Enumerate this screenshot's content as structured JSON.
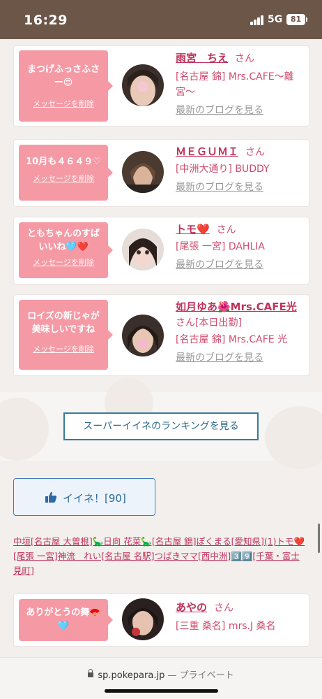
{
  "status_bar": {
    "time": "16:29",
    "network": "5G",
    "battery": "81"
  },
  "cards": [
    {
      "message": "まつげふっさふさー😍",
      "delete_label": "メッセージを削除",
      "name": "雨宮　ちえ",
      "suffix": "さん",
      "shop": "[名古屋 錦] Mrs.CAFE～離宮～",
      "blog_label": "最新のブログを見る"
    },
    {
      "message": "10月も４６４９♡",
      "delete_label": "メッセージを削除",
      "name": "ＭＥＧＵＭＩ",
      "suffix": "さん",
      "shop": "[中洲大通り] BUDDY",
      "blog_label": "最新のブログを見る"
    },
    {
      "message": "ともちゃんのすばいいね🩵❤️",
      "delete_label": "メッセージを削除",
      "name": "トモ❤️",
      "suffix": "さん",
      "shop": "[尾張 一宮] DAHLIA",
      "blog_label": "最新のブログを見る"
    },
    {
      "message": "ロイズの新じゃが美味しいですね",
      "delete_label": "メッセージを削除",
      "name": "如月ゆあ🌺Mrs.CAFE光",
      "suffix": "さん[本日出勤]",
      "shop": "[名古屋 錦] Mrs.CAFE 光",
      "blog_label": "最新のブログを見る"
    },
    {
      "message": "ありがとうの舞🪭🩵",
      "delete_label": "",
      "name": "あやの",
      "suffix": "さん",
      "shop": "[三重 桑名] mrs.J 桑名",
      "blog_label": ""
    }
  ],
  "ranking_button": "スーパーイイネのランキングを見る",
  "like_button": {
    "label": "イイネ！[90]",
    "icon": "thumbs-up-icon"
  },
  "likers": [
    "中垣[名古屋 大曽根]🦕日向 花菜🦕[名古屋 錦]",
    "ぽくまる[愛知県](1)",
    "トモ❤️[尾張 一宮]",
    "神流　れい[名古屋 名駅]",
    "つばきママ[西中洲]",
    "3️⃣9️⃣[千葉・富士見町]"
  ],
  "browser": {
    "domain": "sp.pokepara.jp",
    "mode": "— プライベート"
  },
  "colors": {
    "accent_pink": "#f59aa5",
    "link": "#c0335b",
    "status_bar": "#6b5648"
  }
}
